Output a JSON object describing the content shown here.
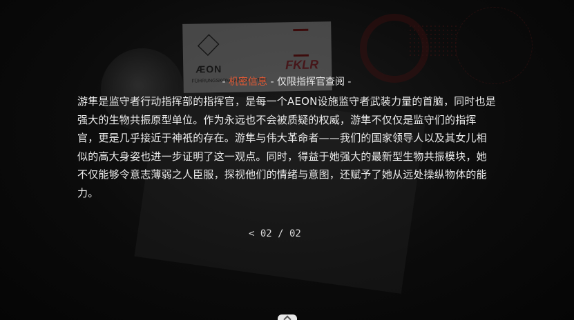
{
  "header": {
    "prefix": "- ",
    "classified_label": "机密信息",
    "separator": " - ",
    "restriction_label": "仅限指挥官查阅",
    "suffix": " -"
  },
  "background": {
    "brand_text": "ÆON",
    "brand_subtext": "FÜHRUNGSKOMMANDO-LEITER",
    "partner_text": "FKLR"
  },
  "document": {
    "body": "游隼是监守者行动指挥部的指挥官，是每一个AEON设施监守者武装力量的首脑，同时也是强大的生物共振原型单位。作为永远也不会被质疑的权威，游隼不仅仅是监守们的指挥官，更是几乎接近于神祇的存在。游隼与伟大革命者——我们的国家领导人以及其女儿相似的高大身姿也进一步证明了这一观点。同时，得益于她强大的最新型生物共振模块，她不仅能够令意志薄弱之人臣服，探视他们的情绪与意图，还赋予了她从远处操纵物体的能力。"
  },
  "pager": {
    "prev_icon": "chevron-left-icon",
    "label": "< 02 / 02"
  },
  "colors": {
    "accent": "#e25a35",
    "text": "#ececec",
    "background": "#050505"
  }
}
